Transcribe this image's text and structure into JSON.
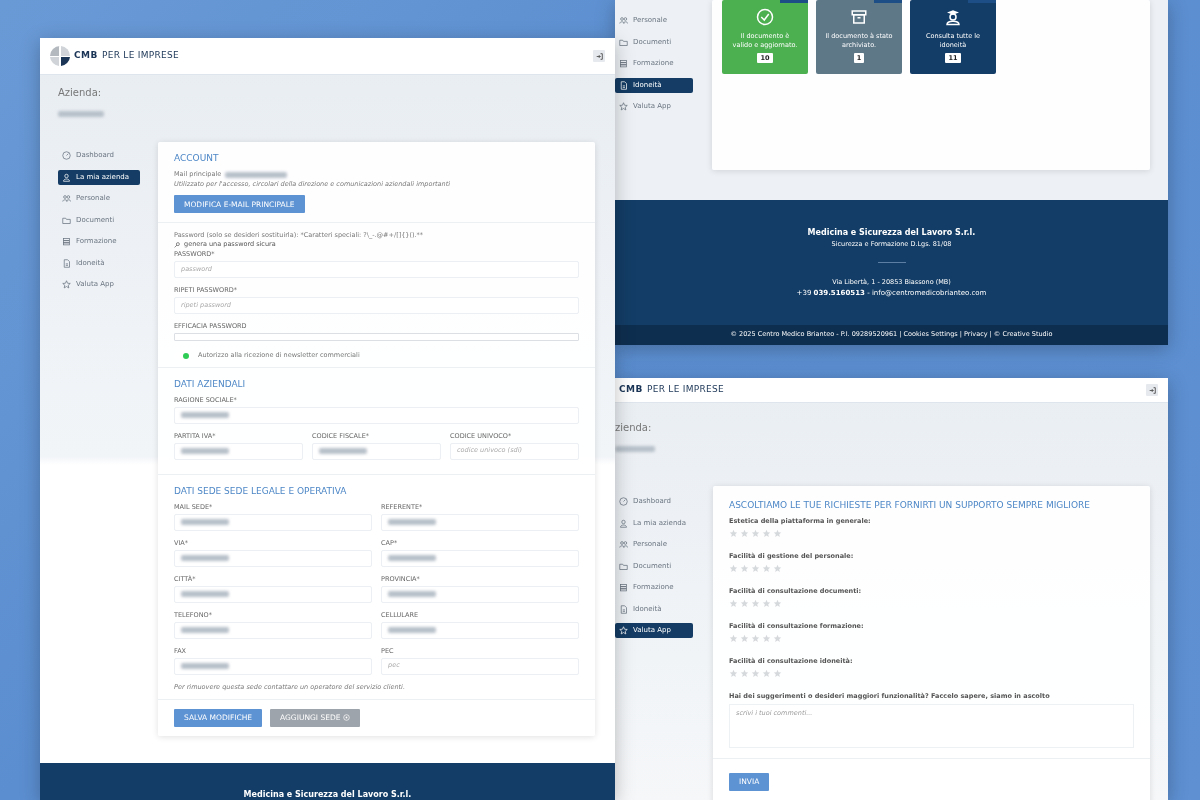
{
  "windows": [
    {
      "kind": "account",
      "logo": {
        "brand": "CMB",
        "tagline": "PER LE IMPRESE"
      },
      "company_label": "Azienda:",
      "company_blurred": true,
      "sidebar": [
        {
          "label": "Dashboard",
          "selected": false
        },
        {
          "label": "La mia azienda",
          "selected": true
        },
        {
          "label": "Personale",
          "selected": false
        },
        {
          "label": "Documenti",
          "selected": false
        },
        {
          "label": "Formazione",
          "selected": false
        },
        {
          "label": "Idoneità",
          "selected": false
        },
        {
          "label": "Valuta App",
          "selected": false
        }
      ],
      "sections": [
        {
          "title": "ACCOUNT",
          "mail_label": "Mail principale",
          "mail_blurred": true,
          "mail_note": "Utilizzato per l'accesso, circolari della direzione e comunicazioni aziendali importanti",
          "mail_button": "MODIFICA E-MAIL PRINCIPALE",
          "password_hint": "Password (solo se desideri sostituirla): *Caratteri speciali: ?\\_-.@#+/[]{}().**",
          "generate_link": "genera una password sicura",
          "rows": [
            [
              {
                "label": "PASSWORD*",
                "placeholder": "password",
                "blurred": false
              }
            ],
            [
              {
                "label": "RIPETI PASSWORD*",
                "placeholder": "ripeti password",
                "blurred": false
              }
            ]
          ],
          "strength": {
            "label": "EFFICACIA PASSWORD",
            "level": 0
          },
          "toggle": {
            "label": "Autorizzo alla ricezione di newsletter commerciali",
            "on": true
          }
        },
        {
          "title": "DATI AZIENDALI",
          "rows": [
            [
              {
                "label": "RAGIONE SOCIALE*",
                "blurred": true
              }
            ],
            [
              {
                "label": "PARTITA IVA*",
                "blurred": true
              },
              {
                "label": "CODICE FISCALE*",
                "blurred": true
              },
              {
                "label": "CODICE UNIVOCO*",
                "placeholder": "codice univoco (sdi)",
                "blurred": false
              }
            ]
          ]
        },
        {
          "title": "DATI SEDE SEDE LEGALE E OPERATIVA",
          "rows": [
            [
              {
                "label": "MAIL SEDE*",
                "blurred": true
              },
              {
                "label": "REFERENTE*",
                "blurred": true
              }
            ],
            [
              {
                "label": "VIA*",
                "blurred": true
              },
              {
                "label": "CAP*",
                "blurred": true
              }
            ],
            [
              {
                "label": "CITTÀ*",
                "blurred": true
              },
              {
                "label": "PROVINCIA*",
                "blurred": true
              }
            ],
            [
              {
                "label": "TELEFONO*",
                "blurred": true
              },
              {
                "label": "CELLULARE",
                "blurred": true
              }
            ],
            [
              {
                "label": "FAX",
                "blurred": true
              },
              {
                "label": "PEC",
                "placeholder": "pec",
                "blurred": false
              }
            ]
          ],
          "note": "Per rimuovere questa sede contattare un operatore del servizio clienti."
        }
      ],
      "buttons": [
        {
          "label": "SALVA MODIFICHE",
          "disabled": false
        },
        {
          "label": "AGGIUNGI SEDE",
          "disabled": true
        }
      ],
      "footer": {
        "title": "Medicina e Sicurezza del Lavoro S.r.l."
      }
    },
    {
      "kind": "idoneita",
      "sidebar": [
        {
          "label": "Personale",
          "selected": false
        },
        {
          "label": "Documenti",
          "selected": false
        },
        {
          "label": "Formazione",
          "selected": false
        },
        {
          "label": "Idoneità",
          "selected": true
        },
        {
          "label": "Valuta App",
          "selected": false
        }
      ],
      "tiles": [
        {
          "text": "Il documento è valido e aggiornato.",
          "count": "10",
          "color": "#4caf50"
        },
        {
          "text": "Il documento à stato archiviato.",
          "count": "1",
          "color": "#5f7888"
        },
        {
          "text": "Consulta tutte le idoneità",
          "count": "11",
          "color": "#133d66"
        }
      ],
      "footer": {
        "title": "Medicina e Sicurezza del Lavoro S.r.l.",
        "subtitle": "Sicurezza e Formazione D.Lgs. 81/08",
        "address": "Via Libertà, 1 - 20853 Biassono (MB)",
        "contact": "+39 **039.5160513** - info@centromedicobrianteo.com",
        "legal": "© 2025 Centro Medico Brianteo - P.I. 09289520961 | Cookies Settings | Privacy | © Creative Studio"
      }
    },
    {
      "kind": "rating",
      "logo": {
        "brand": "CMB",
        "tagline": "PER LE IMPRESE"
      },
      "company_label": "zienda:",
      "company_blurred": true,
      "sidebar": [
        {
          "label": "Dashboard",
          "selected": false
        },
        {
          "label": "La mia azienda",
          "selected": false
        },
        {
          "label": "Personale",
          "selected": false
        },
        {
          "label": "Documenti",
          "selected": false
        },
        {
          "label": "Formazione",
          "selected": false
        },
        {
          "label": "Idoneità",
          "selected": false
        },
        {
          "label": "Valuta App",
          "selected": true
        }
      ],
      "title": "ASCOLTIAMO LE TUE RICHIESTE PER FORNIRTI UN SUPPORTO SEMPRE MIGLIORE",
      "ratings": [
        {
          "label": "Estetica della piattaforma in generale:",
          "stars": 0
        },
        {
          "label": "Facilità di gestione del personale:",
          "stars": 0
        },
        {
          "label": "Facilità di consultazione documenti:",
          "stars": 0
        },
        {
          "label": "Facilità di consultazione formazione:",
          "stars": 0
        },
        {
          "label": "Facilità di consultazione idoneità:",
          "stars": 0
        }
      ],
      "suggestion": {
        "label": "Hai dei suggerimenti o desideri maggiori funzionalità? Faccelo sapere, siamo in ascolto",
        "placeholder": "scrivi i tuoi commenti..."
      },
      "button": "INVIA"
    }
  ]
}
